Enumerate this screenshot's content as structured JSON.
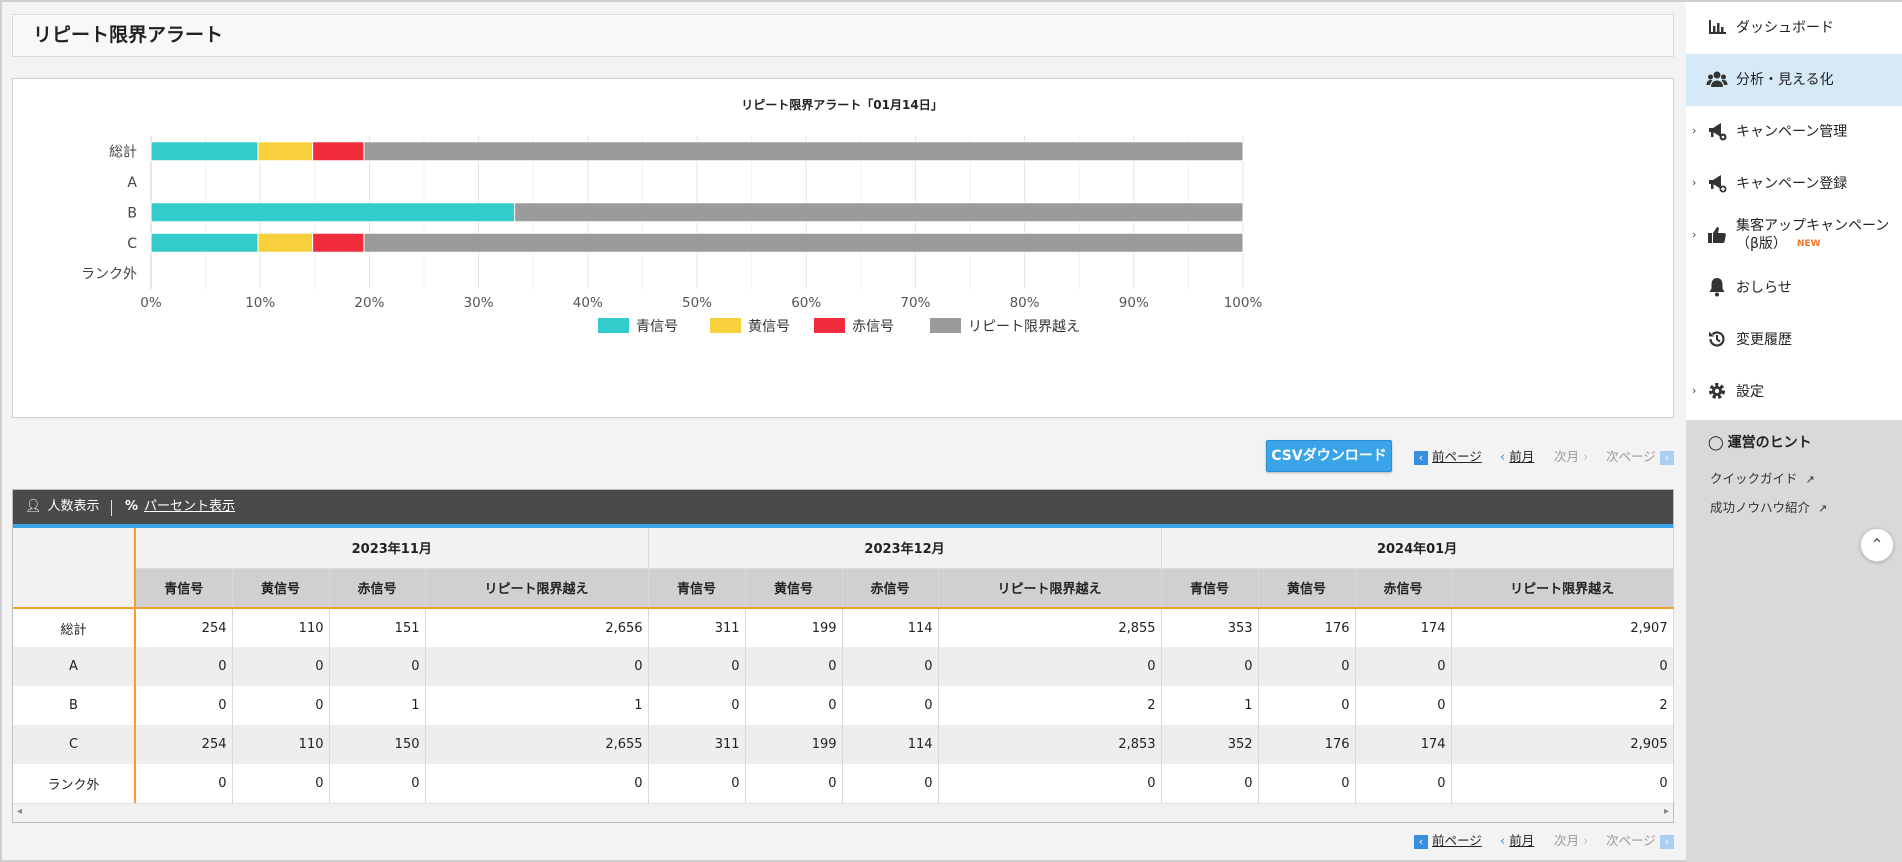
{
  "page_title": "リピート限界アラート",
  "chart_data": {
    "type": "bar",
    "orientation": "horizontal",
    "stacked": true,
    "title": "リピート限界アラート「01月14日」",
    "categories": [
      "総計",
      "A",
      "B",
      "C",
      "ランク外"
    ],
    "series": [
      {
        "name": "青信号",
        "color": "#33cccc",
        "values": [
          9.8,
          0,
          33.3,
          9.8,
          0
        ]
      },
      {
        "name": "黄信号",
        "color": "#f7d03b",
        "values": [
          5.0,
          0,
          0,
          5.0,
          0
        ]
      },
      {
        "name": "赤信号",
        "color": "#f02b3c",
        "values": [
          4.7,
          0,
          0,
          4.7,
          0
        ]
      },
      {
        "name": "リピート限界越え",
        "color": "#9b9b9b",
        "values": [
          80.5,
          0,
          66.7,
          80.5,
          0
        ]
      }
    ],
    "xlim": [
      0,
      100
    ],
    "x_ticks": [
      "0%",
      "10%",
      "20%",
      "30%",
      "40%",
      "50%",
      "60%",
      "70%",
      "80%",
      "90%",
      "100%"
    ],
    "grid": true,
    "legend_position": "bottom"
  },
  "toolbar": {
    "csv_label": "CSVダウンロード",
    "prev_page": "前ページ",
    "prev_month": "前月",
    "next_month": "次月",
    "next_page": "次ページ"
  },
  "table": {
    "view_count_label": "人数表示",
    "view_percent_label": "パーセント表示",
    "months": [
      "2023年11月",
      "2023年12月",
      "2024年01月"
    ],
    "sub_headers": [
      "青信号",
      "黄信号",
      "赤信号",
      "リピート限界越え"
    ],
    "rows": [
      {
        "label": "総計",
        "values": [
          "254",
          "110",
          "151",
          "2,656",
          "311",
          "199",
          "114",
          "2,855",
          "353",
          "176",
          "174",
          "2,907"
        ]
      },
      {
        "label": "A",
        "values": [
          "0",
          "0",
          "0",
          "0",
          "0",
          "0",
          "0",
          "0",
          "0",
          "0",
          "0",
          "0"
        ]
      },
      {
        "label": "B",
        "values": [
          "0",
          "0",
          "1",
          "1",
          "0",
          "0",
          "0",
          "2",
          "1",
          "0",
          "0",
          "2"
        ]
      },
      {
        "label": "C",
        "values": [
          "254",
          "110",
          "150",
          "2,655",
          "311",
          "199",
          "114",
          "2,853",
          "352",
          "176",
          "174",
          "2,905"
        ]
      },
      {
        "label": "ランク外",
        "values": [
          "0",
          "0",
          "0",
          "0",
          "0",
          "0",
          "0",
          "0",
          "0",
          "0",
          "0",
          "0"
        ]
      }
    ]
  },
  "sidebar": {
    "items": [
      {
        "label": "ダッシュボード",
        "icon": "bar-chart-icon"
      },
      {
        "label": "分析・見える化",
        "icon": "users-icon"
      },
      {
        "label": "キャンペーン管理",
        "icon": "megaphone-gear-icon"
      },
      {
        "label": "キャンペーン登録",
        "icon": "megaphone-plus-icon"
      },
      {
        "label": "集客アップキャンペーン",
        "label2": "（β版）",
        "badge": "NEW",
        "icon": "thumbs-up-icon"
      },
      {
        "label": "おしらせ",
        "icon": "bell-icon"
      },
      {
        "label": "変更履歴",
        "icon": "history-icon"
      },
      {
        "label": "設定",
        "icon": "gear-icon"
      }
    ],
    "hints_title": "運営のヒント",
    "hint_links": [
      "クイックガイド",
      "成功ノウハウ紹介"
    ]
  },
  "colors": {
    "accent": "#3aa4e8",
    "header_dark": "#4a4a4a",
    "orange_rule": "#f2a02c",
    "active_nav": "#d6e9f7"
  }
}
